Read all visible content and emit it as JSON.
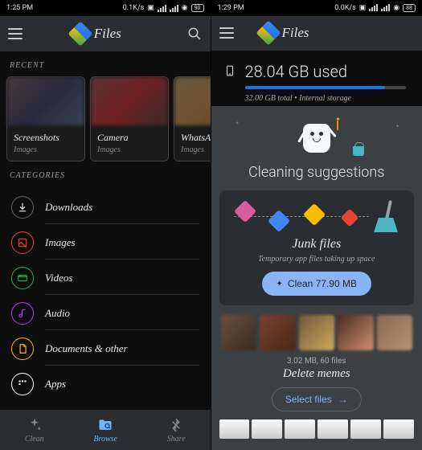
{
  "left": {
    "status": {
      "time": "1:25 PM",
      "net": "0.1K/s"
    },
    "app_title": "Files",
    "recent_label": "RECENT",
    "recent": [
      {
        "title": "Screenshots",
        "sub": "Images"
      },
      {
        "title": "Camera",
        "sub": "Images"
      },
      {
        "title": "WhatsA",
        "sub": "Images"
      }
    ],
    "categories_label": "CATEGORIES",
    "categories": [
      {
        "label": "Downloads",
        "color": "#5f6368"
      },
      {
        "label": "Images",
        "color": "#ea4335"
      },
      {
        "label": "Videos",
        "color": "#34a853"
      },
      {
        "label": "Audio",
        "color": "#a142f4"
      },
      {
        "label": "Documents & other",
        "color": "#fbbc04"
      },
      {
        "label": "Apps",
        "color": "#ffffff"
      }
    ],
    "nav": {
      "clean": "Clean",
      "browse": "Browse",
      "share": "Share"
    }
  },
  "right": {
    "status": {
      "time": "1:29 PM",
      "net": "0.0K/s"
    },
    "app_title": "Files",
    "storage": {
      "used": "28.04 GB used",
      "total_line": "32.00 GB total • Internal storage",
      "percent": 87
    },
    "cleaning_title": "Cleaning suggestions",
    "junk": {
      "title": "Junk files",
      "sub": "Temporary app files taking up space",
      "button": "Clean 77.90 MB"
    },
    "memes": {
      "stats": "3.02 MB, 60 files",
      "title": "Delete memes",
      "button": "Select files"
    }
  }
}
